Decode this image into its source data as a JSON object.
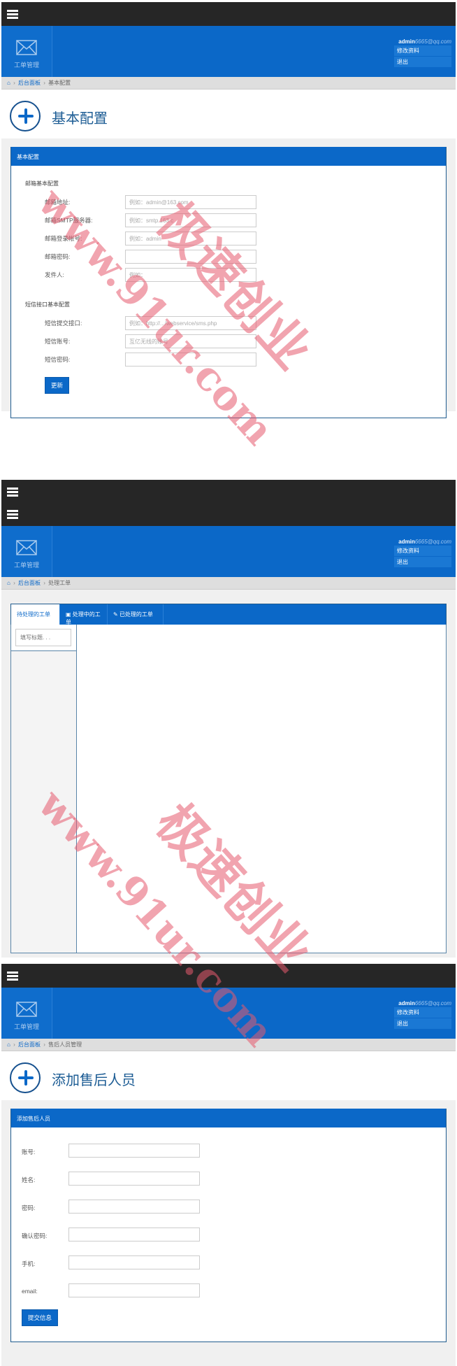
{
  "common": {
    "module_label": "工单管理",
    "user_name": "admin",
    "user_email": "6665@qq.com",
    "edit_profile": "修改资料",
    "logout": "退出",
    "crumb_dashboard": "后台面板",
    "crumb_sep": "›"
  },
  "screen1": {
    "crumb_current": "基本配置",
    "page_title": "基本配置",
    "panel_title": "基本配置",
    "email_section": "邮箱基本配置",
    "email_fields": [
      {
        "label": "邮箱地址:",
        "placeholder": "例如：admin@163.com"
      },
      {
        "label": "邮箱SMTP服务器:",
        "placeholder": "例如：smtp.163.c"
      },
      {
        "label": "邮箱登录帐号:",
        "placeholder": "例如：admin"
      },
      {
        "label": "邮箱密码:",
        "placeholder": ""
      },
      {
        "label": "发件人:",
        "placeholder": "例如："
      }
    ],
    "sms_section": "短信接口基本配置",
    "sms_fields": [
      {
        "label": "短信提交接口:",
        "placeholder": "例如：http://.../webservice/sms.php"
      },
      {
        "label": "短信账号:",
        "placeholder": "互亿无线的账号"
      },
      {
        "label": "短信密码:",
        "placeholder": ""
      }
    ],
    "submit": "更新"
  },
  "screen2": {
    "crumb_current": "处理工单",
    "tabs": [
      {
        "label": "待处理的工单",
        "icon": "",
        "active": true
      },
      {
        "label": "处理中的工单",
        "icon": "inbox-icon",
        "active": false
      },
      {
        "label": "已处理的工单",
        "icon": "edit-icon",
        "active": false
      }
    ],
    "search_placeholder": "填写标题. . ."
  },
  "screen3": {
    "crumb_current": "售后人员管理",
    "page_title": "添加售后人员",
    "panel_title": "添加售后人员",
    "fields": [
      {
        "label": "账号:"
      },
      {
        "label": "姓名:"
      },
      {
        "label": "密码:"
      },
      {
        "label": "确认密码:"
      },
      {
        "label": "手机:"
      },
      {
        "label": "email:"
      }
    ],
    "submit": "提交信息"
  },
  "watermark": {
    "line1": "www.91ur.com",
    "line2": "极速创业"
  }
}
